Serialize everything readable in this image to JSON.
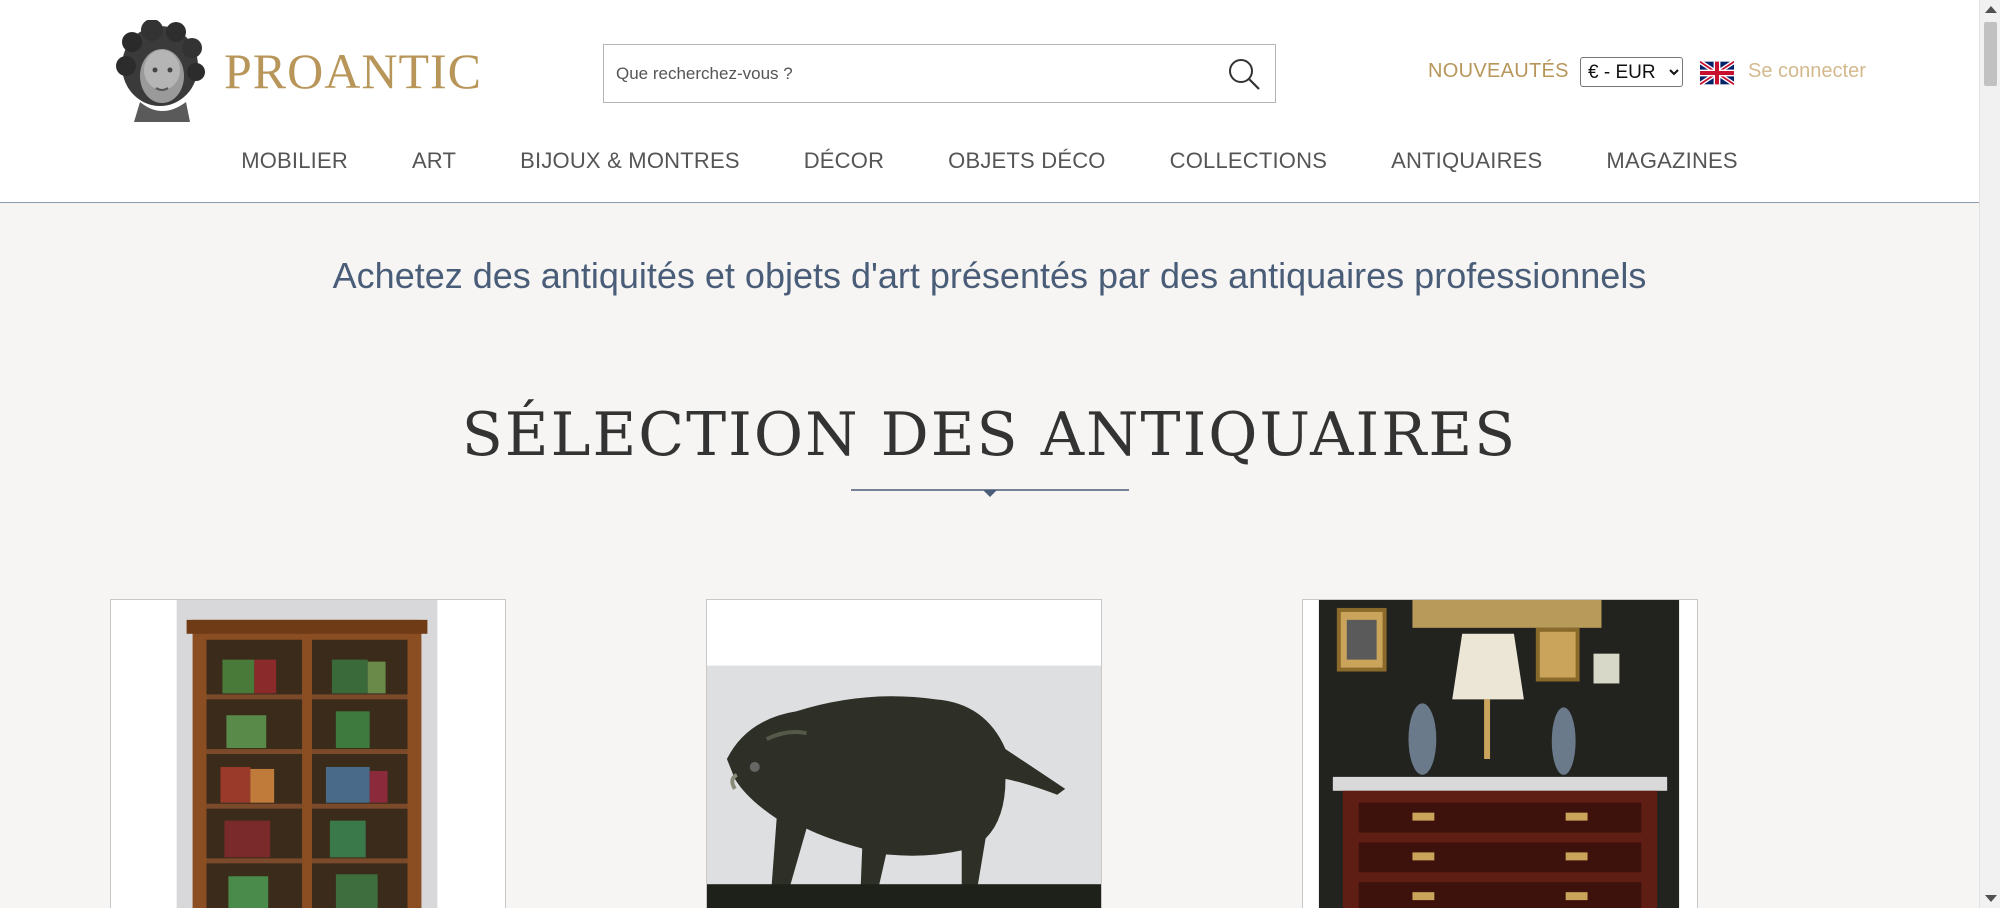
{
  "header": {
    "logo_text": "PROANTIC",
    "logo_icon": "classical-bust-logo",
    "search_placeholder": "Que recherchez-vous ?",
    "nouveautes_label": "NOUVEAUTÉS",
    "currency_selected": "€ - EUR",
    "language_flag": "uk-flag-icon",
    "connect_label": "Se connecter"
  },
  "nav": {
    "items": [
      "MOBILIER",
      "ART",
      "BIJOUX & MONTRES",
      "DÉCOR",
      "OBJETS DÉCO",
      "COLLECTIONS",
      "ANTIQUAIRES",
      "MAGAZINES"
    ]
  },
  "main": {
    "tagline": "Achetez des antiquités et objets d'art présentés par des antiquaires professionnels",
    "section_title": "SÉLECTION DES ANTIQUAIRES"
  },
  "cards": [
    {
      "image": "wooden-bookcase-with-books"
    },
    {
      "image": "bronze-boar-sculpture"
    },
    {
      "image": "louis-xvi-commode-with-lamp"
    }
  ],
  "colors": {
    "gold": "#b8965a",
    "gold_light": "#d3b98d",
    "slate_blue": "#4a5d78",
    "background": "#f6f5f3"
  }
}
